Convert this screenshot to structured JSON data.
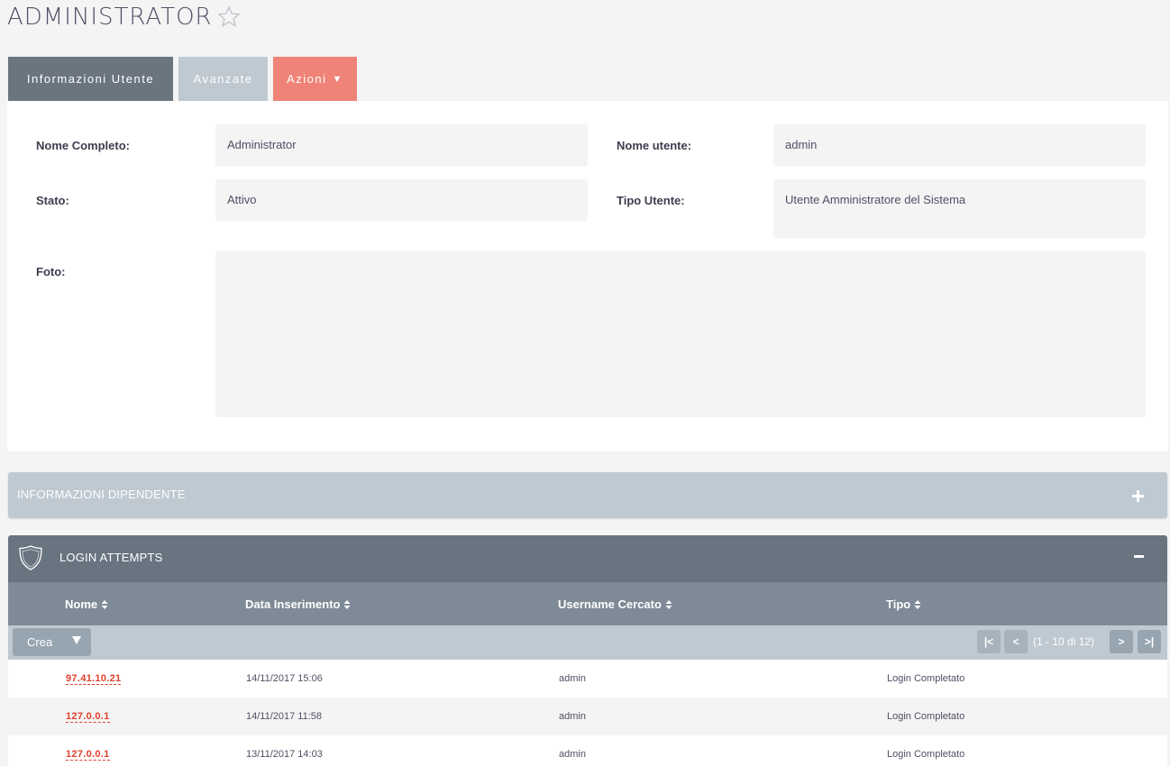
{
  "page": {
    "title": "ADMINISTRATOR"
  },
  "tabs": {
    "info": "Informazioni Utente",
    "advanced": "Avanzate",
    "actions": "Azioni"
  },
  "fields": {
    "full_name": {
      "label": "Nome Completo:",
      "value": "Administrator"
    },
    "username": {
      "label": "Nome utente:",
      "value": "admin"
    },
    "status": {
      "label": "Stato:",
      "value": "Attivo"
    },
    "user_type": {
      "label": "Tipo Utente:",
      "value": "Utente Amministratore del Sistema"
    },
    "photo": {
      "label": "Foto:",
      "value": ""
    }
  },
  "employee_panel": {
    "title": "INFORMAZIONI DIPENDENTE"
  },
  "login_attempts": {
    "title": "LOGIN ATTEMPTS",
    "columns": [
      "Nome",
      "Data Inserimento",
      "Username Cercato",
      "Tipo"
    ],
    "create_label": "Crea",
    "pagination": {
      "first": "|<",
      "prev": "<",
      "info": "(1 - 10 di 12)",
      "next": ">",
      "last": ">|"
    },
    "rows": [
      {
        "name": "97.41.10.21",
        "date": "14/11/2017 15:06",
        "username": "admin",
        "type": "Login Completato"
      },
      {
        "name": "127.0.0.1",
        "date": "14/11/2017 11:58",
        "username": "admin",
        "type": "Login Completato"
      },
      {
        "name": "127.0.0.1",
        "date": "13/11/2017 14:03",
        "username": "admin",
        "type": "Login Completato"
      }
    ]
  },
  "icons": {
    "favorite": "star-icon",
    "expand": "plus-icon",
    "collapse": "minus-icon",
    "subpanel": "shield-icon",
    "sort": "sort-icon"
  },
  "colors": {
    "accent": "#f08377",
    "header": "#687480",
    "link": "#e0412c",
    "tab_active": "#6a7580"
  }
}
